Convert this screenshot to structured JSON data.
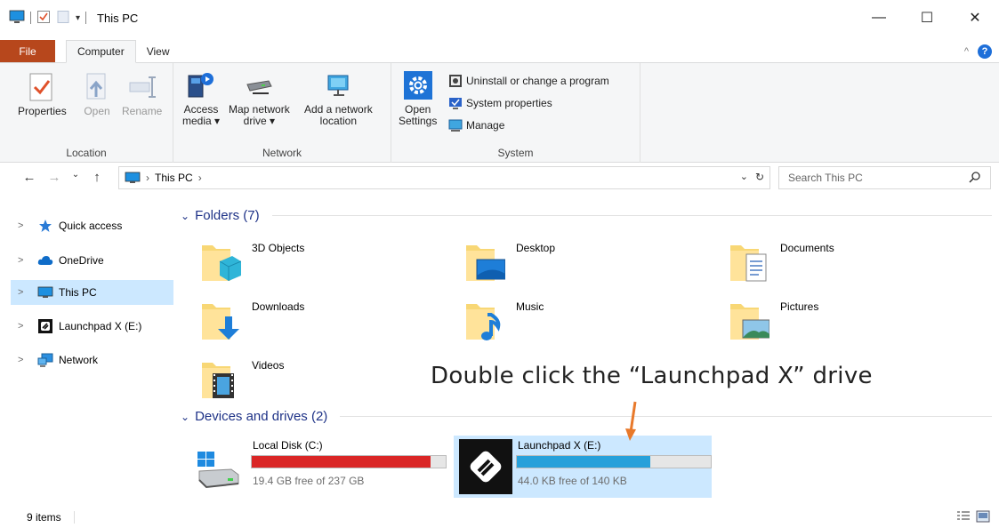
{
  "window": {
    "title": "This PC",
    "controls": {
      "minimize": "—",
      "maximize": "☐",
      "close": "✕"
    }
  },
  "ribbon": {
    "tabs": [
      {
        "label": "File"
      },
      {
        "label": "Computer"
      },
      {
        "label": "View"
      }
    ],
    "groups": {
      "location": {
        "label": "Location",
        "buttons": [
          {
            "label": "Properties"
          },
          {
            "label": "Open"
          },
          {
            "label": "Rename"
          }
        ]
      },
      "network": {
        "label": "Network",
        "buttons": [
          {
            "label": "Access\nmedia ▾"
          },
          {
            "label": "Map network\ndrive ▾"
          },
          {
            "label": "Add a network\nlocation"
          }
        ]
      },
      "system": {
        "label": "System",
        "open_settings": "Open\nSettings",
        "items": [
          {
            "label": "Uninstall or change a program"
          },
          {
            "label": "System properties"
          },
          {
            "label": "Manage"
          }
        ]
      }
    }
  },
  "address": {
    "path": "This PC",
    "search_placeholder": "Search This PC"
  },
  "nav_pane": {
    "items": [
      {
        "label": "Quick access"
      },
      {
        "label": "OneDrive"
      },
      {
        "label": "This PC"
      },
      {
        "label": "Launchpad X (E:)"
      },
      {
        "label": "Network"
      }
    ]
  },
  "content": {
    "folders_header": "Folders (7)",
    "folders": [
      {
        "label": "3D Objects"
      },
      {
        "label": "Desktop"
      },
      {
        "label": "Documents"
      },
      {
        "label": "Downloads"
      },
      {
        "label": "Music"
      },
      {
        "label": "Pictures"
      },
      {
        "label": "Videos"
      }
    ],
    "devices_header": "Devices and drives (2)",
    "drives": [
      {
        "name": "Local Disk (C:)",
        "free": "19.4 GB free of 237 GB",
        "used_fraction": 0.92,
        "bar_color": "#da2626"
      },
      {
        "name": "Launchpad X (E:)",
        "free": "44.0 KB free of 140 KB",
        "used_fraction": 0.69,
        "bar_color": "#26a0da"
      }
    ]
  },
  "annotation": {
    "text": "Double click the “Launchpad X” drive",
    "arrow_color": "#e8792b"
  },
  "status": {
    "item_count": "9 items"
  }
}
